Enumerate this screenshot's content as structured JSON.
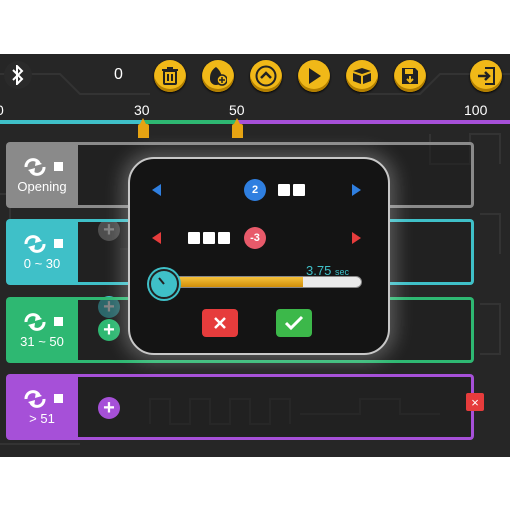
{
  "toolbar": {
    "counter": "0",
    "buttons": [
      {
        "name": "bluetooth-icon"
      },
      {
        "name": "trash-icon"
      },
      {
        "name": "add-bulb-icon"
      },
      {
        "name": "chevron-up-icon"
      },
      {
        "name": "play-icon"
      },
      {
        "name": "box-icon"
      },
      {
        "name": "save-icon"
      },
      {
        "name": "exit-icon"
      }
    ]
  },
  "timeline": {
    "ticks": [
      "0",
      "30",
      "50",
      "100"
    ],
    "colors": {
      "teal": "#3fc0c8",
      "green": "#2eb872",
      "purple": "#a650d8",
      "orange": "#e6a312"
    }
  },
  "rows": [
    {
      "label": "Opening",
      "color": "#8a8a8a"
    },
    {
      "label": "0 ~ 30",
      "color": "#3fc0c8"
    },
    {
      "label": "31 ~ 50",
      "color": "#2eb872"
    },
    {
      "label": "> 51",
      "color": "#a650d8"
    }
  ],
  "dialog": {
    "blue_gear_value": "2",
    "red_gear_value": "-3",
    "duration_value": "3.75",
    "duration_unit": "sec",
    "progress": 0.72,
    "cancel_icon": "close-icon",
    "confirm_icon": "check-icon"
  },
  "delete_label": "×"
}
